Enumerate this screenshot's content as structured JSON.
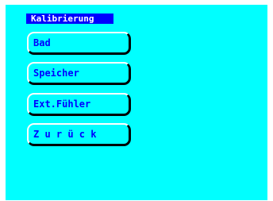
{
  "menu": {
    "title": "Kalibrierung",
    "items": [
      {
        "label": "Bad"
      },
      {
        "label": "Speicher"
      },
      {
        "label": "Ext.Fühler"
      },
      {
        "label": "Z u r ü c k"
      }
    ]
  },
  "colors": {
    "background": "#00ffff",
    "title_bar": "#0000ff",
    "title_text": "#ffffff",
    "button_text": "#0000ff",
    "button_highlight": "#ffffff",
    "button_shadow": "#000000"
  }
}
